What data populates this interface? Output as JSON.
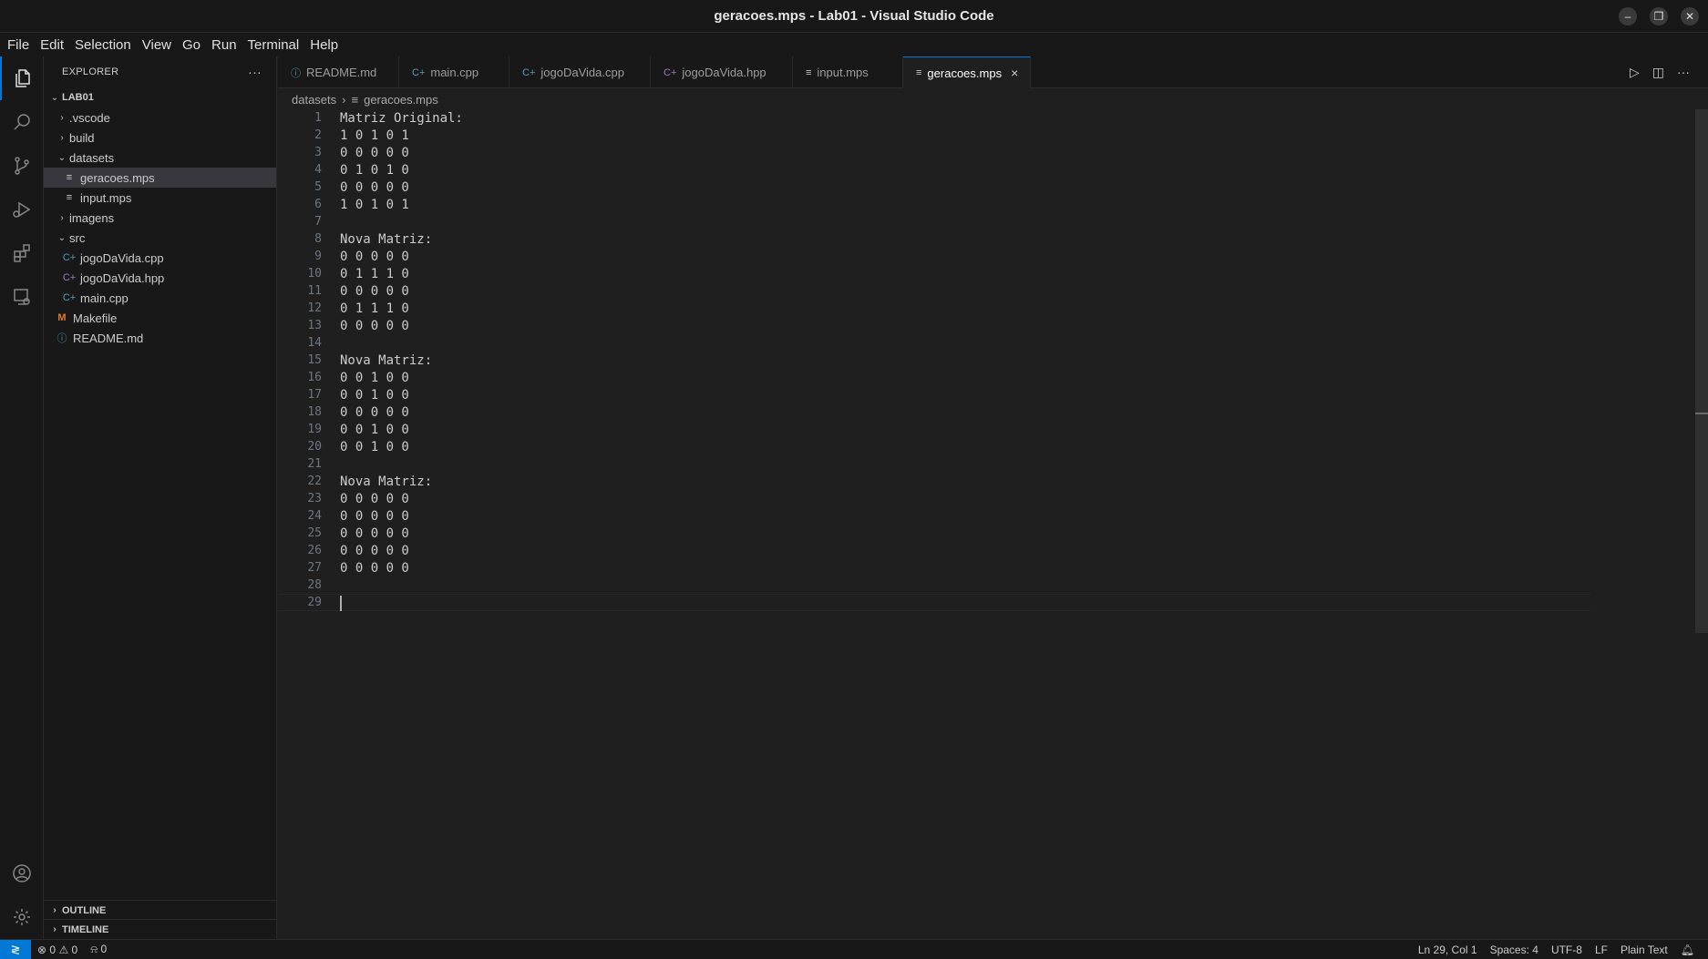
{
  "window": {
    "title": "geracoes.mps - Lab01 - Visual Studio Code"
  },
  "menu": [
    "File",
    "Edit",
    "Selection",
    "View",
    "Go",
    "Run",
    "Terminal",
    "Help"
  ],
  "sidebar": {
    "header": "EXPLORER",
    "root": "LAB01",
    "tree": [
      {
        "label": ".vscode",
        "kind": "folder",
        "expanded": false,
        "depth": 1
      },
      {
        "label": "build",
        "kind": "folder",
        "expanded": false,
        "depth": 1
      },
      {
        "label": "datasets",
        "kind": "folder",
        "expanded": true,
        "depth": 1
      },
      {
        "label": "geracoes.mps",
        "kind": "text",
        "depth": 2,
        "selected": true
      },
      {
        "label": "input.mps",
        "kind": "text",
        "depth": 2
      },
      {
        "label": "imagens",
        "kind": "folder",
        "expanded": false,
        "depth": 1
      },
      {
        "label": "src",
        "kind": "folder",
        "expanded": true,
        "depth": 1
      },
      {
        "label": "jogoDaVida.cpp",
        "kind": "cpp",
        "depth": 2
      },
      {
        "label": "jogoDaVida.hpp",
        "kind": "hpp",
        "depth": 2
      },
      {
        "label": "main.cpp",
        "kind": "cpp",
        "depth": 2
      },
      {
        "label": "Makefile",
        "kind": "makefile",
        "depth": 1
      },
      {
        "label": "README.md",
        "kind": "info",
        "depth": 1
      }
    ],
    "outline": "OUTLINE",
    "timeline": "TIMELINE"
  },
  "tabs": [
    {
      "label": "README.md",
      "kind": "info",
      "active": false
    },
    {
      "label": "main.cpp",
      "kind": "cpp",
      "active": false
    },
    {
      "label": "jogoDaVida.cpp",
      "kind": "cpp",
      "active": false
    },
    {
      "label": "jogoDaVida.hpp",
      "kind": "hpp",
      "active": false
    },
    {
      "label": "input.mps",
      "kind": "text",
      "active": false
    },
    {
      "label": "geracoes.mps",
      "kind": "text",
      "active": true
    }
  ],
  "breadcrumb": {
    "folder": "datasets",
    "file": "geracoes.mps"
  },
  "editor": {
    "current_line": 29,
    "lines": [
      "Matriz Original:",
      "1 0 1 0 1",
      "0 0 0 0 0",
      "0 1 0 1 0",
      "0 0 0 0 0",
      "1 0 1 0 1",
      "",
      "Nova Matriz:",
      "0 0 0 0 0",
      "0 1 1 1 0",
      "0 0 0 0 0",
      "0 1 1 1 0",
      "0 0 0 0 0",
      "",
      "Nova Matriz:",
      "0 0 1 0 0",
      "0 0 1 0 0",
      "0 0 0 0 0",
      "0 0 1 0 0",
      "0 0 1 0 0",
      "",
      "Nova Matriz:",
      "0 0 0 0 0",
      "0 0 0 0 0",
      "0 0 0 0 0",
      "0 0 0 0 0",
      "0 0 0 0 0",
      "",
      ""
    ]
  },
  "statusbar": {
    "errors": "0",
    "warnings": "0",
    "ports": "0",
    "position": "Ln 29, Col 1",
    "spaces": "Spaces: 4",
    "encoding": "UTF-8",
    "eol": "LF",
    "language": "Plain Text"
  },
  "colors": {
    "accent": "#0078d4",
    "cpp_icon": "#519aba",
    "hpp_icon": "#a074c4",
    "makefile_icon": "#e37933",
    "info_icon": "#519aba"
  }
}
